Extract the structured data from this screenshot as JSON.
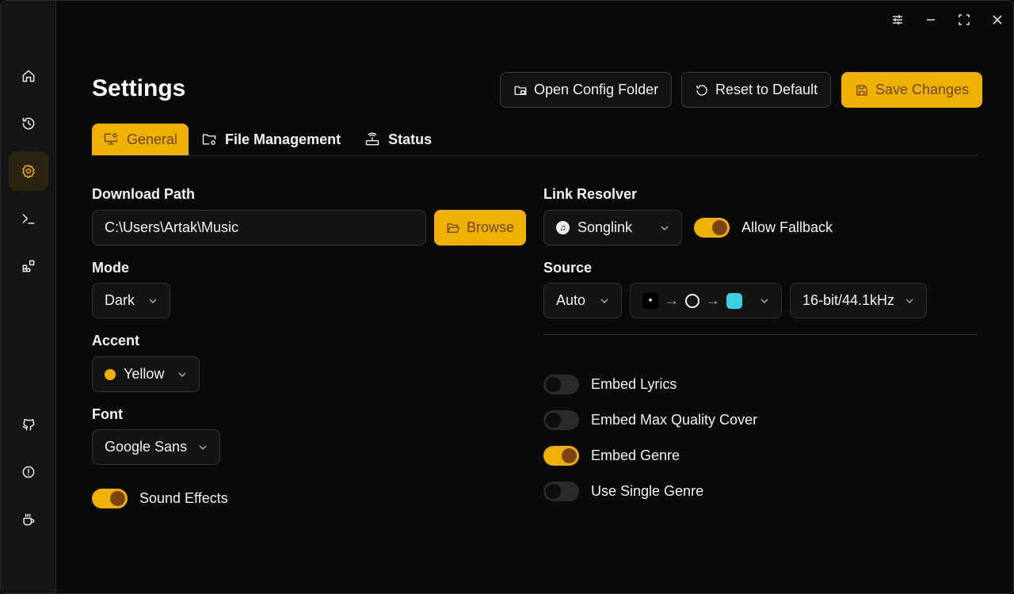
{
  "page": {
    "title": "Settings"
  },
  "header": {
    "open_config": "Open Config Folder",
    "reset": "Reset to Default",
    "save": "Save Changes"
  },
  "tabs": [
    {
      "label": "General"
    },
    {
      "label": "File Management"
    },
    {
      "label": "Status"
    }
  ],
  "general": {
    "download_path_label": "Download Path",
    "download_path": "C:\\Users\\Artak\\Music",
    "browse": "Browse",
    "mode_label": "Mode",
    "mode": "Dark",
    "accent_label": "Accent",
    "accent": "Yellow",
    "accent_color": "#f0b000",
    "font_label": "Font",
    "font": "Google Sans",
    "sound_effects": "Sound Effects",
    "sound_effects_on": true
  },
  "resolver": {
    "label": "Link Resolver",
    "value": "Songlink",
    "allow_fallback": "Allow Fallback",
    "allow_fallback_on": true
  },
  "source": {
    "label": "Source",
    "mode": "Auto",
    "quality": "16-bit/44.1kHz",
    "chain": [
      "tidal-icon",
      "qobuz-icon",
      "amazon-music-icon"
    ]
  },
  "options": [
    {
      "label": "Embed Lyrics",
      "on": false
    },
    {
      "label": "Embed Max Quality Cover",
      "on": false
    },
    {
      "label": "Embed Genre",
      "on": true
    },
    {
      "label": "Use Single Genre",
      "on": false
    }
  ]
}
